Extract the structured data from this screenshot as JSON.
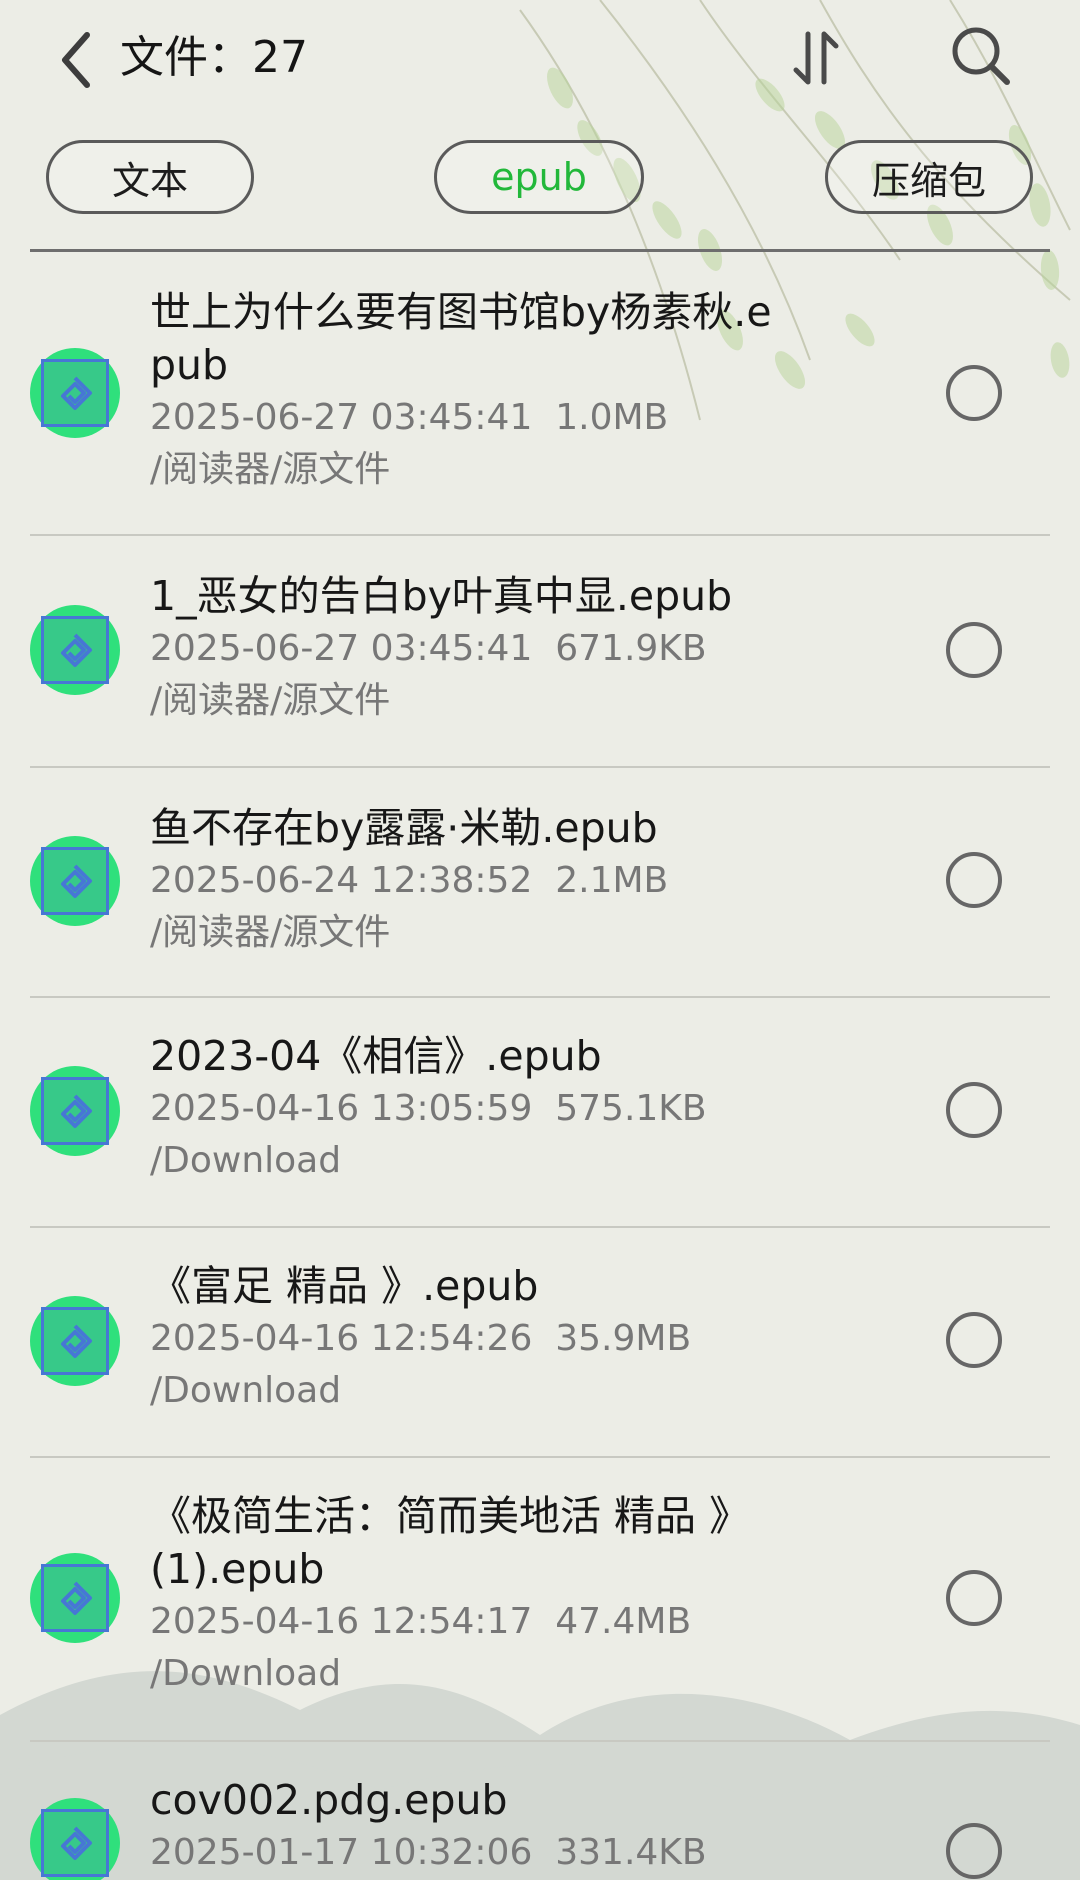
{
  "header": {
    "title": "文件：27",
    "icons": {
      "back": "chevron-left-icon",
      "sort": "sort-icon",
      "search": "search-icon"
    }
  },
  "filters": {
    "items": [
      {
        "label": "文本",
        "active": false
      },
      {
        "label": "epub",
        "active": true
      },
      {
        "label": "压缩包",
        "active": false
      }
    ],
    "active_color": "#22b83a"
  },
  "files": [
    {
      "name": "世上为什么要有图书馆by杨素秋.epub",
      "meta": "2025-06-27 03:45:41  1.0MB",
      "path": "/阅读器/源文件"
    },
    {
      "name": "1_恶女的告白by叶真中显.epub",
      "meta": "2025-06-27 03:45:41  671.9KB",
      "path": "/阅读器/源文件"
    },
    {
      "name": "鱼不存在by露露·米勒.epub",
      "meta": "2025-06-24 12:38:52  2.1MB",
      "path": "/阅读器/源文件"
    },
    {
      "name": "2023-04《相信》.epub",
      "meta": "2025-04-16 13:05:59  575.1KB",
      "path": "/Download"
    },
    {
      "name": "《富足 精品 》.epub",
      "meta": "2025-04-16 12:54:26  35.9MB",
      "path": "/Download"
    },
    {
      "name": "《极简生活：简而美地活 精品 》(1).epub",
      "meta": "2025-04-16 12:54:17  47.4MB",
      "path": "/Download"
    },
    {
      "name": "cov002.pdg.epub",
      "meta": "2025-01-17 10:32:06  331.4KB",
      "path": ""
    }
  ],
  "colors": {
    "background": "#ecede6",
    "icon_green": "#2fe07c",
    "icon_blue": "#4777d5"
  }
}
